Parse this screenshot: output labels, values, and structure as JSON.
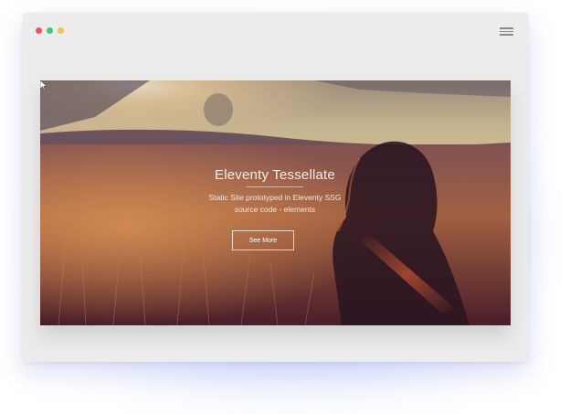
{
  "window": {
    "dots": [
      "#f05454",
      "#3cc97b",
      "#f3c543"
    ],
    "menu_icon": "hamburger-menu-icon"
  },
  "hero": {
    "title": "Eleventy Tessellate",
    "subtitle_line1": "Static Site prototyped in Eleventy SSG",
    "subtitle_line2": "source code - elements",
    "button_label": "See More",
    "background_icon": "sunset-field-photo"
  },
  "colors": {
    "window_bg": "#ececec",
    "glow": "#8aa0ff"
  }
}
